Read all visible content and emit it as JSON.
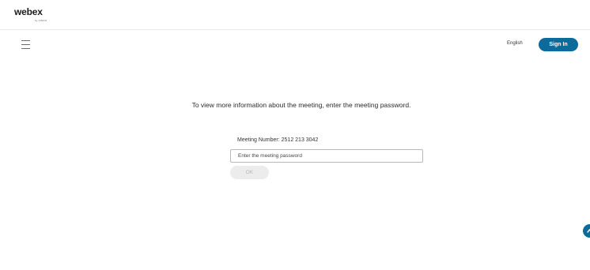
{
  "brand": {
    "name": "webex",
    "sub": "by CISCO"
  },
  "nav": {
    "menu_icon": "hamburger-menu-icon",
    "language": "English",
    "signin_label": "Sign In",
    "signin_color": "#0d6b9c"
  },
  "main": {
    "prompt": "To view more information about the meeting, enter the meeting password.",
    "meeting_number_label": "Meeting Number: 2512 213 3042",
    "password_placeholder": "Enter the meeting password",
    "password_value": "",
    "ok_label": "OK"
  },
  "help": {
    "icon": "help-arrow-icon",
    "color": "#0d6b9c"
  }
}
